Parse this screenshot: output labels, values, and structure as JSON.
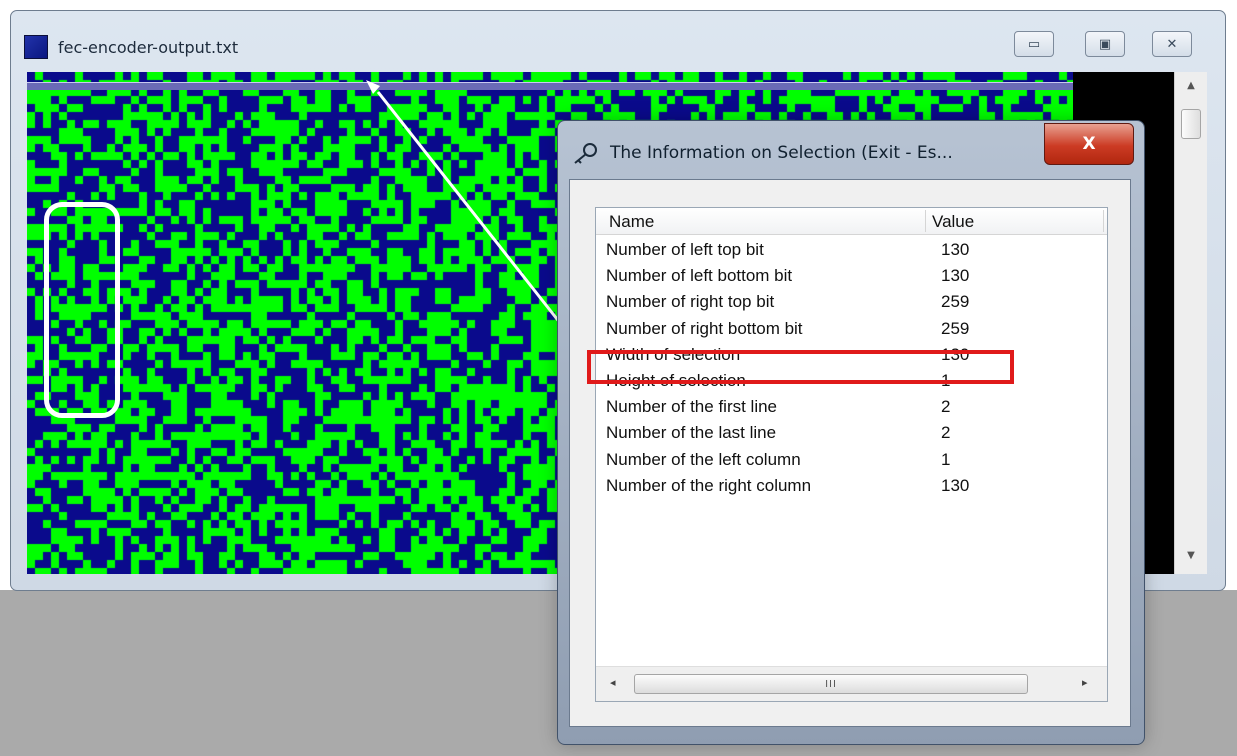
{
  "window": {
    "title": "fec-encoder-output.txt",
    "icon": "app-window-icon",
    "buttons": [
      {
        "name": "minimize-button",
        "glyph": "▭"
      },
      {
        "name": "maximize-button",
        "glyph": "▣"
      },
      {
        "name": "close-button",
        "glyph": "✕"
      }
    ]
  },
  "bitmap": {
    "color_one": "#00ff00",
    "color_zero": "#0a0a8c",
    "selection_color": "#6a6ab6",
    "annotation_color": "#ffffff"
  },
  "scrollbar": {
    "up_glyph": "▲",
    "down_glyph": "▼"
  },
  "dialog": {
    "title": "The Information on Selection (Exit - Es...",
    "icon": "key-icon",
    "close_glyph": "X",
    "columns": [
      "Name",
      "Value"
    ],
    "rows": [
      {
        "name": "Number of left top bit",
        "value": "130"
      },
      {
        "name": "Number of left bottom bit",
        "value": "130"
      },
      {
        "name": "Number of right top bit",
        "value": "259"
      },
      {
        "name": "Number of right bottom bit",
        "value": "259"
      },
      {
        "name": "Width of selection",
        "value": "130"
      },
      {
        "name": "Height of selection",
        "value": "1"
      },
      {
        "name": "Number of the first line",
        "value": "2"
      },
      {
        "name": "Number of the last line",
        "value": "2"
      },
      {
        "name": "Number of the left column",
        "value": "1"
      },
      {
        "name": "Number of the right column",
        "value": "130"
      }
    ],
    "hscroll": {
      "left_glyph": "◂",
      "right_glyph": "▸",
      "thumb_grip": "III"
    }
  },
  "highlight_color": "#e01a1a"
}
